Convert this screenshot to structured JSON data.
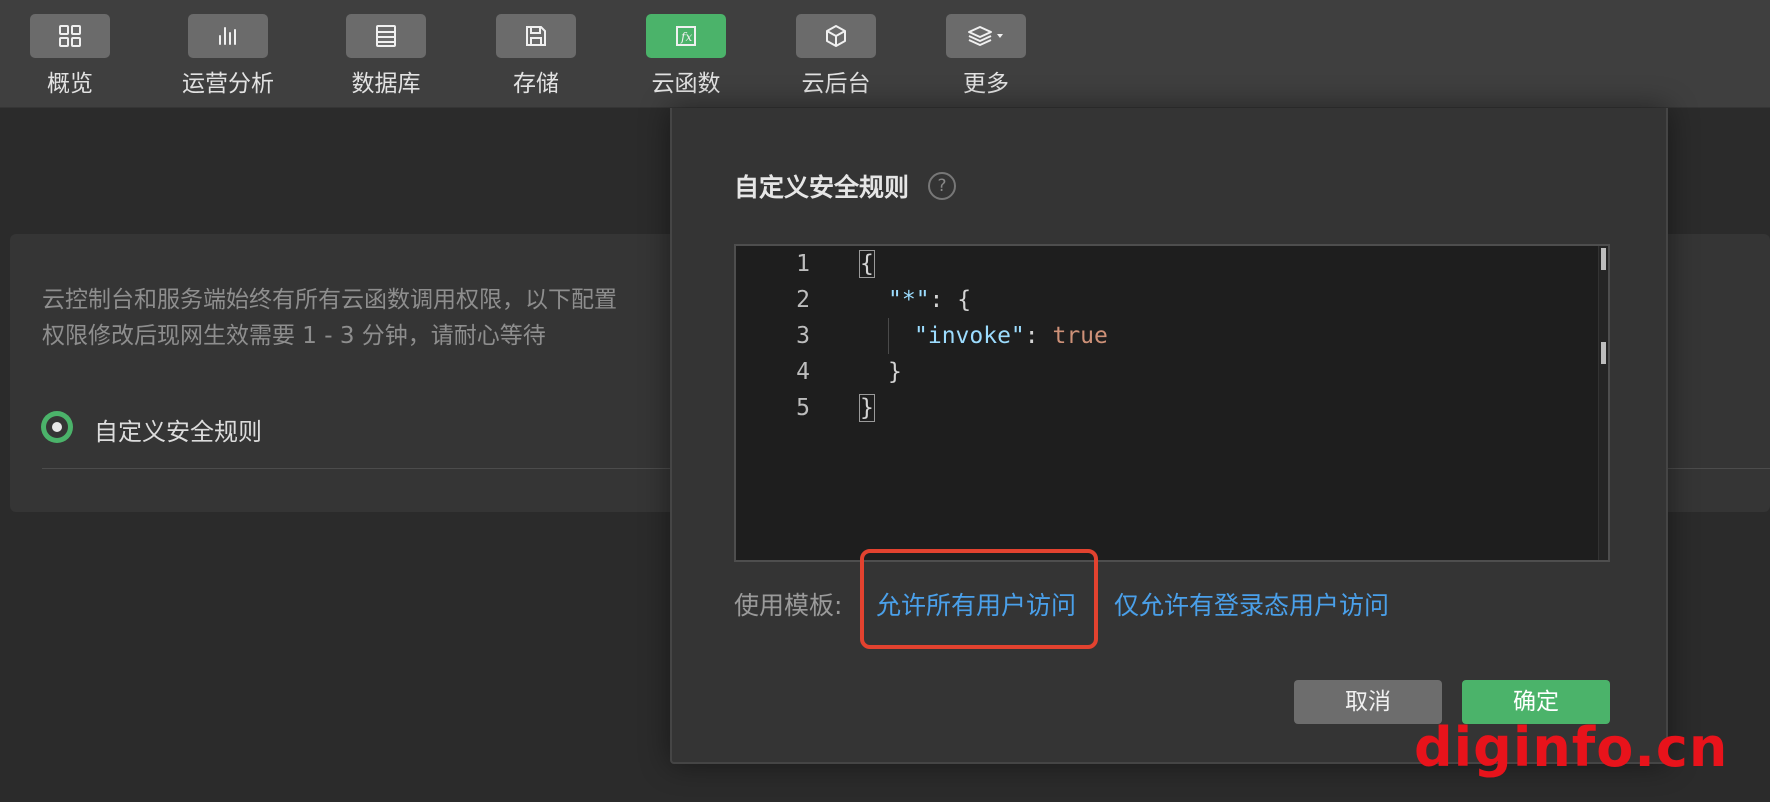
{
  "toolbar": {
    "items": [
      {
        "label": "概览",
        "icon": "grid-icon",
        "active": false
      },
      {
        "label": "运营分析",
        "icon": "bar-chart-icon",
        "active": false
      },
      {
        "label": "数据库",
        "icon": "database-icon",
        "active": false
      },
      {
        "label": "存储",
        "icon": "save-icon",
        "active": false
      },
      {
        "label": "云函数",
        "icon": "function-icon",
        "active": true
      },
      {
        "label": "云后台",
        "icon": "cube-icon",
        "active": false
      },
      {
        "label": "更多",
        "icon": "layers-dropdown-icon",
        "active": false
      }
    ]
  },
  "background": {
    "description_line1": "云控制台和服务端始终有所有云函数调用权限，以下配置",
    "description_line2": "权限修改后现网生效需要 1 - 3 分钟，请耐心等待",
    "radio_label": "自定义安全规则"
  },
  "modal": {
    "title": "自定义安全规则",
    "help_glyph": "?",
    "editor": {
      "lines": [
        {
          "n": "1",
          "text": "{"
        },
        {
          "n": "2",
          "key": "\"*\"",
          "rest": ": {"
        },
        {
          "n": "3",
          "key": "\"invoke\"",
          "rest": ": ",
          "value": "true"
        },
        {
          "n": "4",
          "text": "}"
        },
        {
          "n": "5",
          "text": "}"
        }
      ]
    },
    "templates": {
      "label": "使用模板:",
      "allow_all": "允许所有用户访问",
      "allow_logged_in": "仅允许有登录态用户访问"
    },
    "buttons": {
      "cancel": "取消",
      "ok": "确定"
    }
  },
  "watermark": "diginfo.cn",
  "colors": {
    "accent_green": "#4bb36a",
    "link_blue": "#4aa0ea",
    "highlight_red": "#e2422f",
    "watermark_red": "#e8131b"
  }
}
